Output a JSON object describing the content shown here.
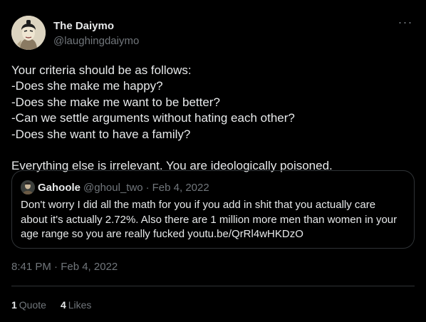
{
  "author": {
    "display_name": "The Daiymo",
    "handle": "@laughingdaiymo"
  },
  "more_icon": "ellipsis-icon",
  "body": {
    "lines": [
      "Your criteria should be as follows:",
      "-Does she make me happy?",
      "-Does she make me want to be better?",
      "-Can we settle arguments without hating each other?",
      "-Does she want to have a family?"
    ],
    "closing": "Everything else is irrelevant. You are ideologically poisoned."
  },
  "quote": {
    "display_name": "Gahoole",
    "handle": "@ghoul_two",
    "separator": "·",
    "date": "Feb 4, 2022",
    "lines": [
      "Don't worry I did all the math for you if you add in shit that you actually care",
      "about it's actually 2.72%. Also there are 1 million more men than women in your",
      "age range so you are really fucked youtu.be/QrRl4wHKDzO"
    ]
  },
  "timestamp": "8:41 PM · Feb 4, 2022",
  "stats": {
    "quotes_count": "1",
    "quotes_label": "Quote",
    "likes_count": "4",
    "likes_label": "Likes"
  },
  "colors": {
    "background": "#000000",
    "text": "#e7e9ea",
    "secondary": "#71767b",
    "border": "#2f3336"
  }
}
